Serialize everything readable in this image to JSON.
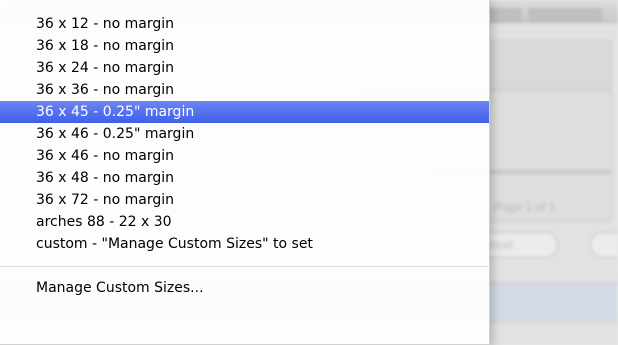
{
  "background": {
    "cancel_label": "Cancel",
    "page_label": "Page 1 of 1"
  },
  "menu": {
    "items": [
      {
        "label": "36 x 12 - no margin",
        "selected": false
      },
      {
        "label": "36 x 18 - no margin",
        "selected": false
      },
      {
        "label": "36 x 24 - no margin",
        "selected": false
      },
      {
        "label": "36 x 36 - no margin",
        "selected": false
      },
      {
        "label": "36 x 45 - 0.25\" margin",
        "selected": true
      },
      {
        "label": "36 x 46 - 0.25\" margin",
        "selected": false
      },
      {
        "label": "36 x 46 - no margin",
        "selected": false
      },
      {
        "label": "36 x 48 - no margin",
        "selected": false
      },
      {
        "label": "36 x 72 - no margin",
        "selected": false
      },
      {
        "label": "arches 88 - 22 x 30",
        "selected": false
      },
      {
        "label": "custom - \"Manage Custom Sizes\" to set",
        "selected": false
      }
    ],
    "manage_label": "Manage Custom Sizes...",
    "highlight_color": "#3e5fe9"
  }
}
